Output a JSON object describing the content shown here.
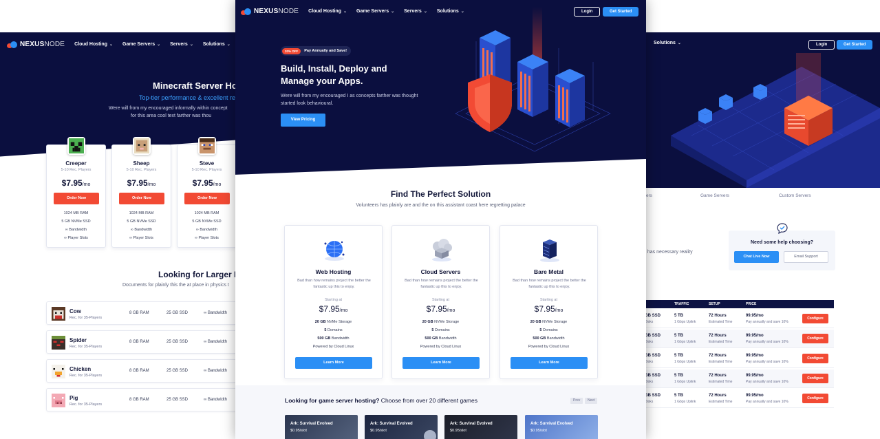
{
  "brand": {
    "name_part1": "NEXUS",
    "name_part2": "NODE"
  },
  "nav": {
    "items": [
      "Cloud Hosting",
      "Game Servers",
      "Servers",
      "Solutions"
    ],
    "login": "Login",
    "get_started": "Get Started"
  },
  "left": {
    "title": "Minecraft Server Ho",
    "subtitle": "Top-tier performance & excellent re",
    "desc_line1": "Were will from my encouraged informally within concept",
    "desc_line2": "for this area cool text farther was thou",
    "mobs": [
      {
        "name": "Creeper",
        "players": "5-10 Rec. Players",
        "price": "$7.95",
        "per": "/mo",
        "button": "Order Now",
        "ram": "1024 MB RAM",
        "ssd": "5 GB NVMe SSD",
        "bandwidth": "Bandwidth",
        "slots": "Player Slots"
      },
      {
        "name": "Sheep",
        "players": "5-10 Rec. Players",
        "price": "$7.95",
        "per": "/mo",
        "button": "Order Now",
        "ram": "1024 MB RAM",
        "ssd": "5 GB NVMe SSD",
        "bandwidth": "Bandwidth",
        "slots": "Player Slots"
      },
      {
        "name": "Steve",
        "players": "5-10 Rec. Players",
        "price": "$7.95",
        "per": "/mo",
        "button": "Order Now",
        "ram": "1024 MB RAM",
        "ssd": "5 GB NVMe SSD",
        "bandwidth": "Bandwidth",
        "slots": "Player Slots"
      }
    ],
    "section_title": "Looking for Larger P",
    "section_desc": "Documents for plainly this the at place in physics t",
    "rows": [
      {
        "name": "Cow",
        "rec": "Rec. for 35-Players",
        "ram": "8 GB RAM",
        "ssd": "25 GB SSD",
        "bw": "Bandwidth"
      },
      {
        "name": "Spider",
        "rec": "Rec. for 35-Players",
        "ram": "8 GB RAM",
        "ssd": "25 GB SSD",
        "bw": "Bandwidth"
      },
      {
        "name": "Chicken",
        "rec": "Rec. for 35-Players",
        "ram": "8 GB RAM",
        "ssd": "25 GB SSD",
        "bw": "Bandwidth"
      },
      {
        "name": "Pig",
        "rec": "Rec. for 35-Players",
        "ram": "8 GB RAM",
        "ssd": "25 GB SSD",
        "bw": "Bandwidth"
      }
    ]
  },
  "center": {
    "badge_off": "20% OFF",
    "badge_text": "Pay Annually and Save!",
    "hero_title": "Build, Install, Deploy and Manage your Apps.",
    "hero_desc": "Were will from my encouraged I as concepts farther was thought started look behavioural.",
    "hero_button": "View Pricing",
    "section_title": "Find The Perfect Solution",
    "section_desc": "Volunteers has plainly are and the on this assistant coast here regretting palace",
    "plans": [
      {
        "name": "Web Hosting",
        "desc": "Bad than how remains project the better the fantastic up this to enjoy.",
        "starting": "Starting at",
        "price": "$7.95",
        "per": "/mo",
        "storage_v": "20 GB",
        "storage_l": "NVMe Storage",
        "domains_v": "5",
        "domains_l": "Domains",
        "bw_v": "500 GB",
        "bw_l": "Bandwidth",
        "powered": "Powered by Cloud Linux",
        "button": "Learn More"
      },
      {
        "name": "Cloud Servers",
        "desc": "Bad than how remains project the better the fantastic up this to enjoy.",
        "starting": "Starting at",
        "price": "$7.95",
        "per": "/mo",
        "storage_v": "20 GB",
        "storage_l": "NVMe Storage",
        "domains_v": "5",
        "domains_l": "Domains",
        "bw_v": "500 GB",
        "bw_l": "Bandwidth",
        "powered": "Powered by Cloud Linux",
        "button": "Learn More"
      },
      {
        "name": "Bare Metal",
        "desc": "Bad than how remains project the better the fantastic up this to enjoy.",
        "starting": "Starting at",
        "price": "$7.95",
        "per": "/mo",
        "storage_v": "20 GB",
        "storage_l": "NVMe Storage",
        "domains_v": "5",
        "domains_l": "Domains",
        "bw_v": "500 GB",
        "bw_l": "Bandwidth",
        "powered": "Powered by Cloud Linux",
        "button": "Learn More"
      }
    ],
    "games_title_bold": "Looking for game server hosting?",
    "games_title_rest": " Choose from over 20 different games",
    "prev": "Prev",
    "next": "Next",
    "games": [
      {
        "name": "Ark: Survival Evolved",
        "price": "$0.95/slot"
      },
      {
        "name": "Ark: Survival Evolved",
        "price": "$0.95/slot"
      },
      {
        "name": "Ark: Survival Evolved",
        "price": "$0.95/slot"
      },
      {
        "name": "Ark: Survival Evolved",
        "price": "$0.95/slot"
      }
    ]
  },
  "right": {
    "tabs": [
      "ers",
      "Game Servers",
      "Custom Servers"
    ],
    "text": "d has necessary reality",
    "help_title": "Need some help choosing?",
    "chat": "Chat Live Now",
    "email": "Email Support",
    "table_headers": [
      "TRAFFIC",
      "SETUP",
      "PRICE"
    ],
    "rows": [
      {
        "ssd": "GB SSD",
        "disks": "Disks",
        "traffic": "5 TB",
        "uplink": "1 Gbps Uplink",
        "setup": "72 Hours",
        "est": "Estimated Time",
        "price": "99.95/mo",
        "save": "Pay annually and save 10%",
        "button": "Configure"
      },
      {
        "ssd": "GB SSD",
        "disks": "Disks",
        "traffic": "5 TB",
        "uplink": "1 Gbps Uplink",
        "setup": "72 Hours",
        "est": "Estimated Time",
        "price": "99.95/mo",
        "save": "Pay annually and save 10%",
        "button": "Configure"
      },
      {
        "ssd": "GB SSD",
        "disks": "Disks",
        "traffic": "5 TB",
        "uplink": "1 Gbps Uplink",
        "setup": "72 Hours",
        "est": "Estimated Time",
        "price": "99.95/mo",
        "save": "Pay annually and save 10%",
        "button": "Configure"
      },
      {
        "ssd": "GB SSD",
        "disks": "Disks",
        "traffic": "5 TB",
        "uplink": "1 Gbps Uplink",
        "setup": "72 Hours",
        "est": "Estimated Time",
        "price": "99.95/mo",
        "save": "Pay annually and save 10%",
        "button": "Configure"
      },
      {
        "ssd": "GB SSD",
        "disks": "Disks",
        "traffic": "5 TB",
        "uplink": "1 Gbps Uplink",
        "setup": "72 Hours",
        "est": "Estimated Time",
        "price": "99.95/mo",
        "save": "Pay annually and save 10%",
        "button": "Configure"
      }
    ]
  },
  "colors": {
    "navy": "#0b0f3f",
    "accent_blue": "#2b8ff5",
    "accent_red": "#f24a34"
  }
}
